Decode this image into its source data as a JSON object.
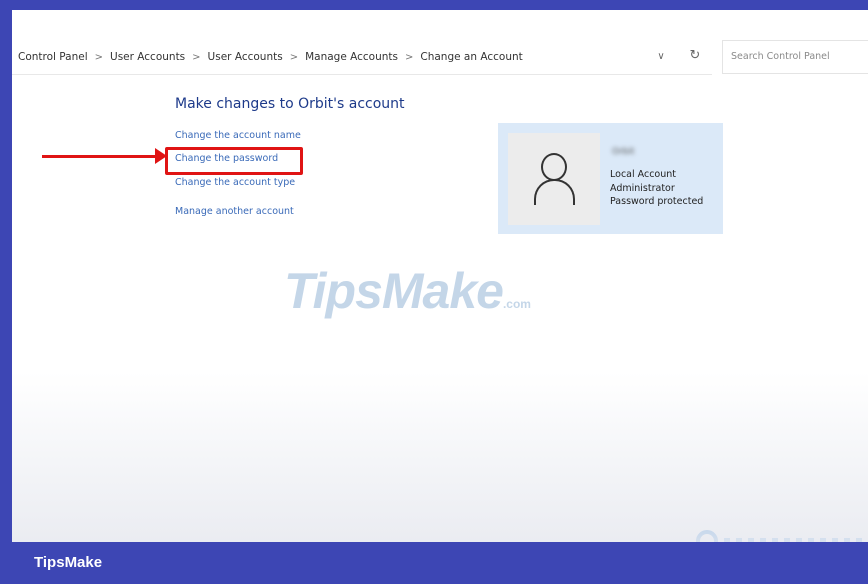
{
  "breadcrumb": [
    "Control Panel",
    "User Accounts",
    "User Accounts",
    "Manage Accounts",
    "Change an Account"
  ],
  "breadcrumb_separator": ">",
  "search": {
    "placeholder": "Search Control Panel"
  },
  "icons": {
    "dropdown": "chevron-down-icon",
    "refresh": "refresh-icon",
    "avatar": "user-icon"
  },
  "page": {
    "title": "Make changes to Orbit's account"
  },
  "tasks": [
    {
      "label": "Change the account name"
    },
    {
      "label": "Change the password"
    },
    {
      "label": "Change the account type"
    },
    {
      "label": "Manage another account"
    }
  ],
  "account": {
    "name": "Orbit",
    "details": [
      "Local Account",
      "Administrator",
      "Password protected"
    ]
  },
  "watermark": {
    "main": "TipsMake",
    "suffix": ".com"
  },
  "footer": {
    "brand": "TipsMake"
  },
  "colors": {
    "frame": "#3d46b4",
    "link": "#3a6ab8",
    "title": "#1d3a8a",
    "highlight": "#e01414",
    "card": "#dbe9f8"
  }
}
